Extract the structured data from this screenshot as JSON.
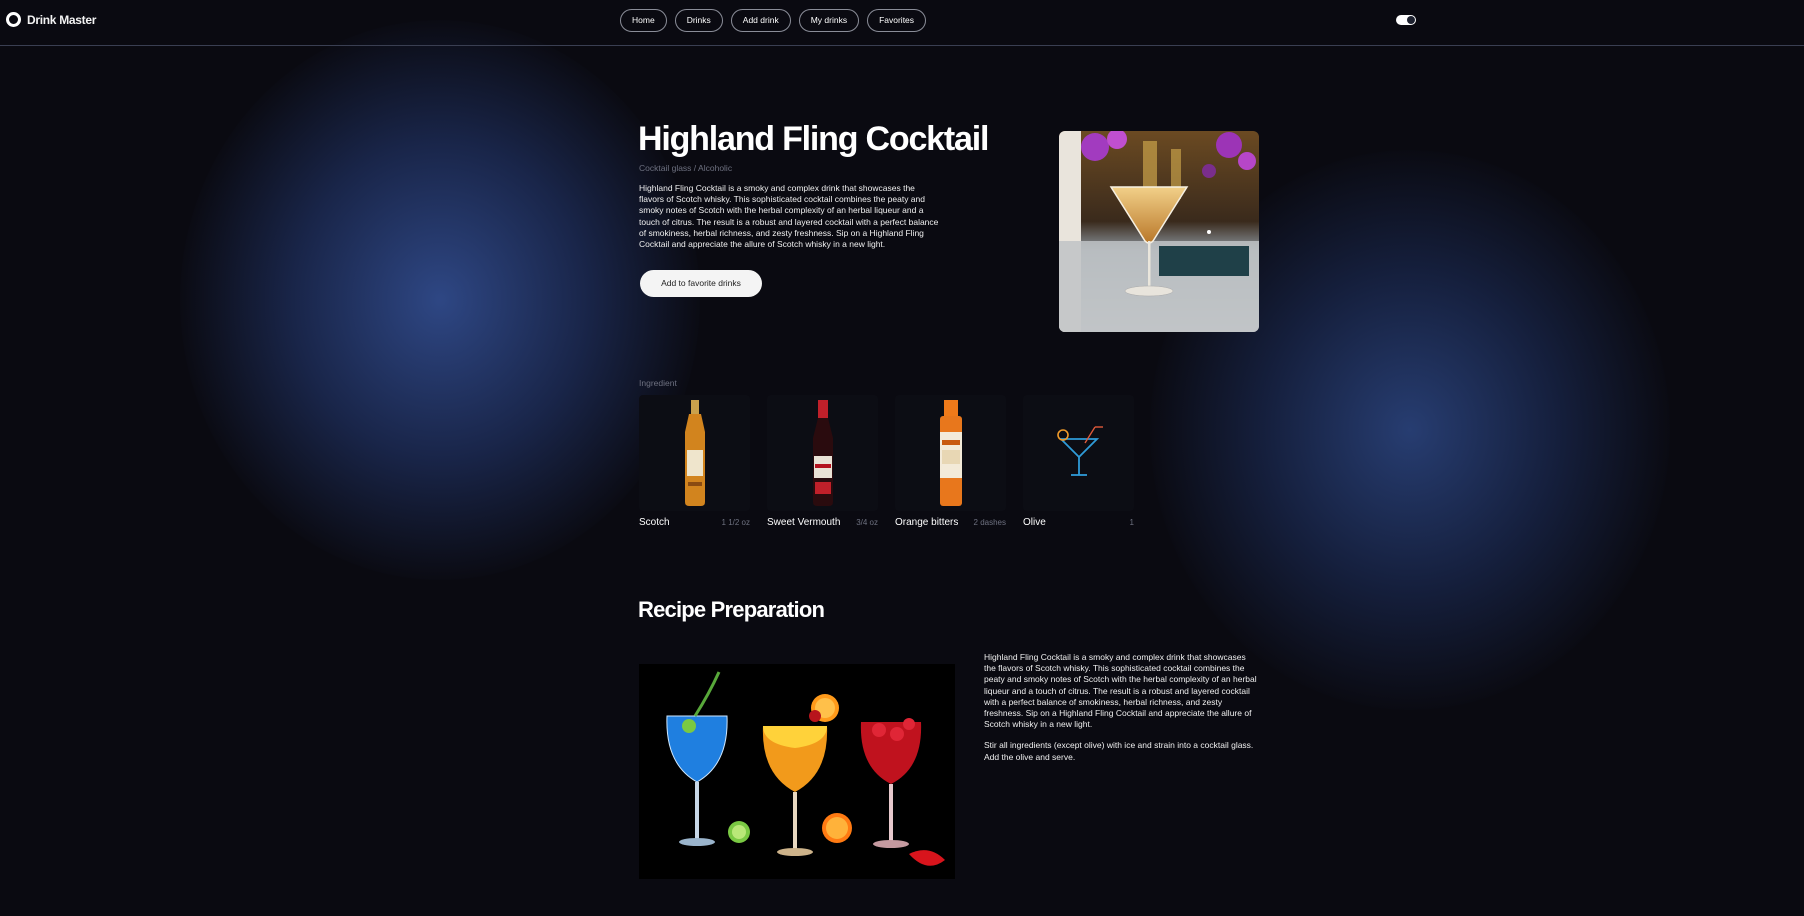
{
  "app": {
    "name": "Drink Master"
  },
  "nav": [
    {
      "label": "Home"
    },
    {
      "label": "Drinks"
    },
    {
      "label": "Add drink"
    },
    {
      "label": "My drinks"
    },
    {
      "label": "Favorites"
    }
  ],
  "theme_toggle": {
    "state": "on"
  },
  "drink": {
    "title": "Highland Fling Cocktail",
    "subtitle": "Cocktail glass / Alcoholic",
    "description": "Highland Fling Cocktail is a smoky and complex drink that showcases the flavors of Scotch whisky. This sophisticated cocktail combines the peaty and smoky notes of Scotch with the herbal complexity of an herbal liqueur and a touch of citrus. The result is a robust and layered cocktail with a perfect balance of smokiness, herbal richness, and zesty freshness. Sip on a Highland Fling Cocktail and appreciate the allure of Scotch whisky in a new light.",
    "favorite_button": "Add to favorite drinks"
  },
  "ingredients": {
    "label": "Ingredient",
    "items": [
      {
        "name": "Scotch",
        "amount": "1 1/2 oz",
        "icon": "scotch-bottle"
      },
      {
        "name": "Sweet Vermouth",
        "amount": "3/4 oz",
        "icon": "vermouth-bottle"
      },
      {
        "name": "Orange bitters",
        "amount": "2 dashes",
        "icon": "bitters-bottle"
      },
      {
        "name": "Olive",
        "amount": "1",
        "icon": "cocktail-glass"
      }
    ]
  },
  "recipe": {
    "title": "Recipe Preparation",
    "paragraph1": "Highland Fling Cocktail is a smoky and complex drink that showcases the flavors of Scotch whisky. This sophisticated cocktail combines the peaty and smoky notes of Scotch with the herbal complexity of an herbal liqueur and a touch of citrus. The result is a robust and layered cocktail with a perfect balance of smokiness, herbal richness, and zesty freshness. Sip on a Highland Fling Cocktail and appreciate the allure of Scotch whisky in a new light.",
    "paragraph2": "Stir all ingredients (except olive) with ice and strain into a cocktail glass. Add the olive and serve."
  },
  "colors": {
    "background": "#0a0a11",
    "glow": "#304a8a",
    "text": "#ffffff",
    "muted": "#6e7180",
    "button_bg": "#f4f4f4"
  }
}
